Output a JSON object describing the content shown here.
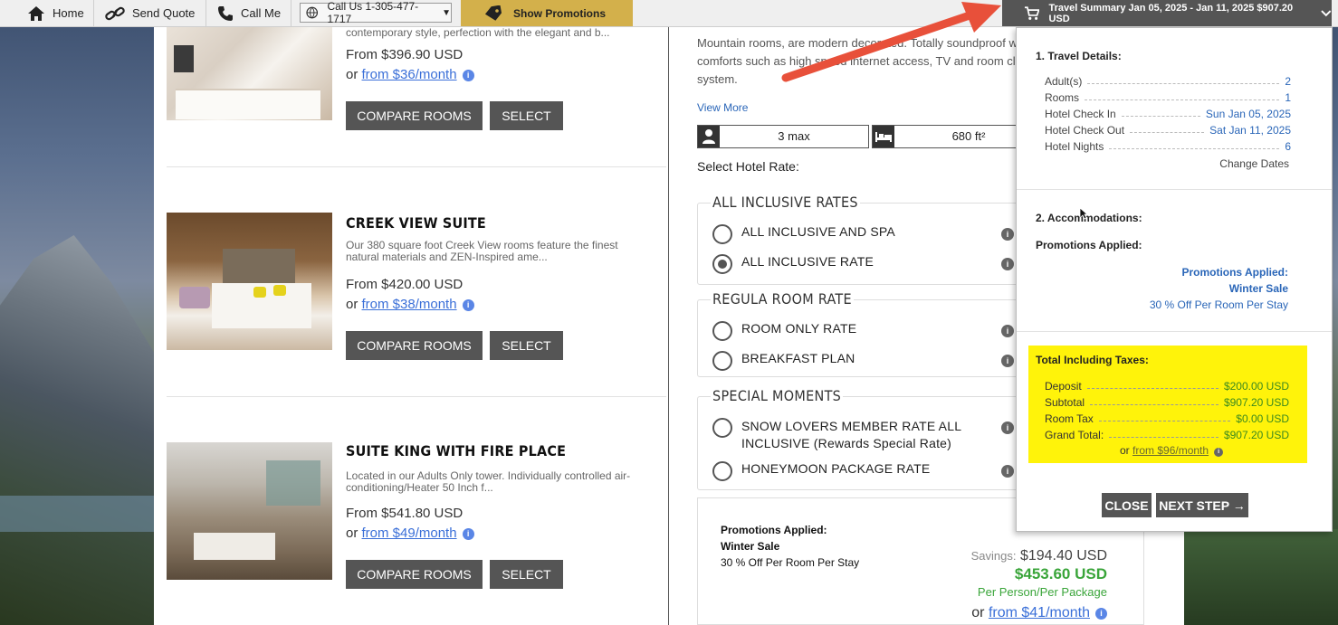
{
  "nav": {
    "home": "Home",
    "send_quote": "Send Quote",
    "call_me": "Call Me",
    "call_us": "Call Us  1-305-477-1717",
    "show_promotions": "Show Promotions",
    "travel_summary": "Travel Summary Jan 05, 2025 - Jan 11, 2025 $907.20 USD"
  },
  "rooms": [
    {
      "title": "",
      "desc": "contemporary style, perfection with the elegant and b...",
      "price": "From $396.90 USD",
      "monthly_prefix": "or ",
      "monthly_link": "from $36/month",
      "compare": "COMPARE ROOMS",
      "select": "SELECT"
    },
    {
      "title": "CREEK VIEW SUITE",
      "desc": "Our 380 square foot Creek View rooms feature the finest natural materials and ZEN-Inspired ame...",
      "price": "From $420.00 USD",
      "monthly_prefix": "or ",
      "monthly_link": "from $38/month",
      "compare": "COMPARE ROOMS",
      "select": "SELECT"
    },
    {
      "title": "SUITE KING WITH FIRE PLACE",
      "desc": "Located in our Adults Only tower.  Individually controlled air-conditioning/Heater 50 Inch f...",
      "price": "From $541.80 USD",
      "monthly_prefix": "or ",
      "monthly_link": "from $49/month",
      "compare": "COMPARE ROOMS",
      "select": "SELECT"
    }
  ],
  "detail": {
    "description": "Mountain rooms, are modern decorated.  Totally soundproof with high tech comforts such as high speed internet access, TV and room cleaning touch system.",
    "view_more": "View More",
    "max_guests": "3 max",
    "size": "680 ft²",
    "select_rate_label": "Select Hotel Rate:",
    "groups": [
      {
        "title": "ALL INCLUSIVE RATES",
        "options": [
          {
            "label": "ALL INCLUSIVE AND SPA",
            "selected": false
          },
          {
            "label": "ALL INCLUSIVE RATE",
            "selected": true
          }
        ]
      },
      {
        "title": "REGULA ROOM RATE",
        "options": [
          {
            "label": "ROOM ONLY RATE",
            "selected": false
          },
          {
            "label": "BREAKFAST PLAN",
            "selected": false
          }
        ]
      },
      {
        "title": "SPECIAL MOMENTS",
        "options": [
          {
            "label": "SNOW LOVERS MEMBER RATE ALL INCLUSIVE (Rewards Special Rate)",
            "selected": false
          },
          {
            "label": "HONEYMOON PACKAGE RATE",
            "selected": false
          }
        ]
      }
    ],
    "promo_box": {
      "applied_label": "Promotions Applied:",
      "promo_name": "Winter Sale",
      "promo_desc": "30 % Off Per Room Per Stay",
      "savings_label": "Savings:",
      "savings_value": "$194.40 USD",
      "price": "$453.60 USD",
      "per": "Per Person/Per Package",
      "monthly_prefix": "or ",
      "monthly_link": "from $41/month"
    }
  },
  "summary": {
    "travel_details_title": "1. Travel Details:",
    "rows": [
      {
        "k": "Adult(s)",
        "v": "2"
      },
      {
        "k": "Rooms",
        "v": "1"
      },
      {
        "k": "Hotel Check In",
        "v": "Sun Jan 05, 2025"
      },
      {
        "k": "Hotel Check Out",
        "v": "Sat Jan 11, 2025"
      },
      {
        "k": "Hotel Nights",
        "v": "6"
      }
    ],
    "change_dates": "Change Dates",
    "accommodations_title": "2. Accommodations:",
    "promotions_applied": "Promotions Applied:",
    "promo_link_label": "Promotions Applied:",
    "promo_name": "Winter Sale",
    "promo_desc": "30 % Off Per Room Per Stay",
    "totals_title": "Total Including Taxes:",
    "totals": [
      {
        "k": "Deposit",
        "v": "$200.00 USD"
      },
      {
        "k": "Subtotal",
        "v": "$907.20 USD"
      },
      {
        "k": "Room Tax",
        "v": "$0.00 USD"
      },
      {
        "k": "Grand Total:",
        "v": "$907.20 USD"
      }
    ],
    "monthly_prefix": "or ",
    "monthly_link": "from $96/month",
    "close": "CLOSE",
    "next_step": "NEXT STEP →"
  },
  "colors": {
    "accent_link": "#3a6fd8",
    "promo_gold": "#d3b04b",
    "total_yellow": "#fff30a",
    "price_green": "#3c8a1f",
    "arrow_red": "#e8503a"
  }
}
